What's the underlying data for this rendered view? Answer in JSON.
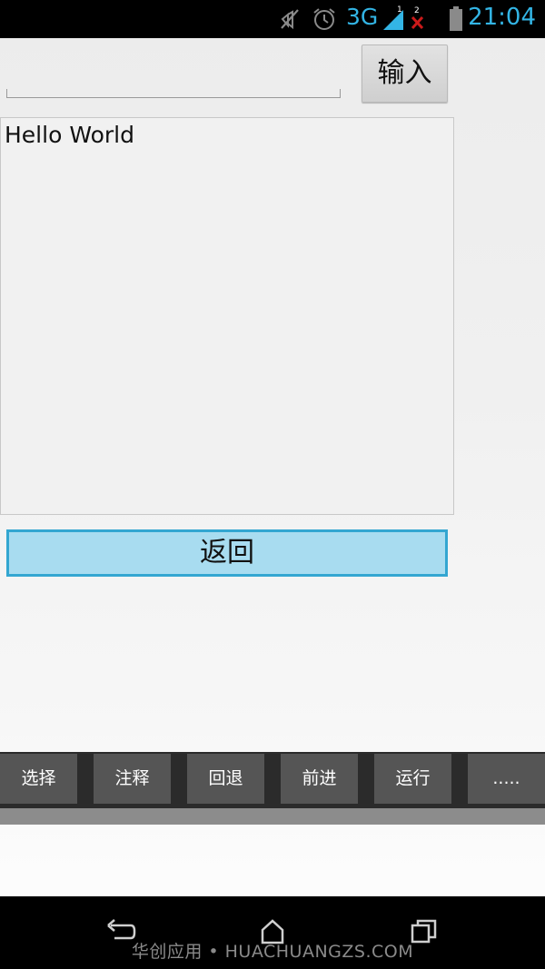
{
  "status_bar": {
    "network": "3G",
    "signal_sim1": "1",
    "signal_sim2": "2",
    "time": "21:04",
    "accent_color": "#33b5e5"
  },
  "input_row": {
    "input_value": "",
    "enter_label": "输入"
  },
  "output": {
    "text": "Hello World"
  },
  "back_label": "返回",
  "toolbar": {
    "items": [
      "选择",
      "注释",
      "回退",
      "前进",
      "运行",
      "....."
    ]
  },
  "navbar": {
    "icons": [
      "back-icon",
      "home-icon",
      "recent-apps-icon"
    ]
  },
  "watermark": "华创应用 • HUACHUANGZS.COM"
}
